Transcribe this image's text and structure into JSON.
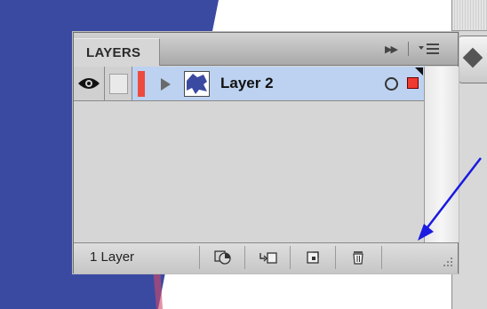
{
  "panel": {
    "tab_label": "LAYERS",
    "layer": {
      "name": "Layer 2",
      "visible": true,
      "color": "#ee4a3e"
    },
    "footer": {
      "count_label": "1 Layer",
      "buttons": [
        "make-clipping-mask",
        "create-sublayer",
        "create-layer",
        "delete-layer"
      ]
    }
  },
  "colors": {
    "artwork_blue": "#3b4aa1",
    "selection_row": "#bcd2f0",
    "layer_color": "#ee4a3e",
    "arrow_annotation": "#1a1ae0"
  }
}
